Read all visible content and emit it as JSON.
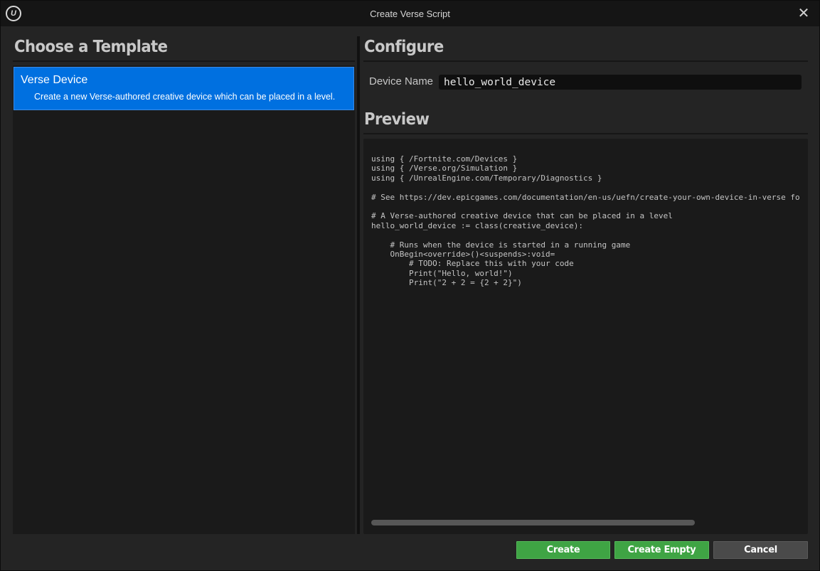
{
  "window": {
    "title": "Create Verse Script",
    "app_icon": "unreal-logo-icon",
    "close_icon": "close-icon",
    "close_glyph": "✕",
    "logo_glyph": "U"
  },
  "left": {
    "title": "Choose a Template",
    "templates": [
      {
        "name": "Verse Device",
        "description": "Create a new Verse-authored creative device which can be placed in a level.",
        "selected": true
      }
    ]
  },
  "configure": {
    "title": "Configure",
    "device_name_label": "Device Name",
    "device_name_value": "hello_world_device"
  },
  "preview": {
    "title": "Preview",
    "code_lines": [
      "using { /Fortnite.com/Devices }",
      "using { /Verse.org/Simulation }",
      "using { /UnrealEngine.com/Temporary/Diagnostics }",
      "",
      "# See https://dev.epicgames.com/documentation/en-us/uefn/create-your-own-device-in-verse fo",
      "",
      "# A Verse-authored creative device that can be placed in a level",
      "hello_world_device := class(creative_device):",
      "",
      "    # Runs when the device is started in a running game",
      "    OnBegin<override>()<suspends>:void=",
      "        # TODO: Replace this with your code",
      "        Print(\"Hello, world!\")",
      "        Print(\"2 + 2 = {2 + 2}\")"
    ]
  },
  "buttons": {
    "create": "Create",
    "create_empty": "Create Empty",
    "cancel": "Cancel"
  },
  "colors": {
    "selection": "#0070e0",
    "primary_button": "#3fa444",
    "secondary_button": "#4a4a4a",
    "background": "#242424",
    "panel": "#1a1a1a"
  }
}
